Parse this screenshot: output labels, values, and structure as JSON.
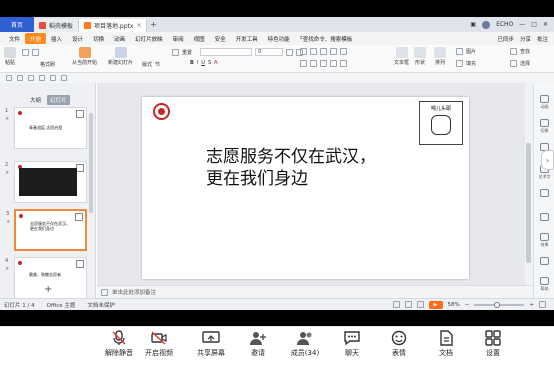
{
  "app": {
    "home_tab": "首页",
    "tabs": [
      {
        "label": "稻壳模板"
      },
      {
        "label": "项目落地.pptx"
      }
    ],
    "tab_add": "+",
    "user": "ECHO"
  },
  "menubar": {
    "items": [
      "文件",
      "开始",
      "插入",
      "设计",
      "切换",
      "动画",
      "幻灯片放映",
      "审阅",
      "视图",
      "安全",
      "开发工具",
      "特色功能"
    ],
    "search": "查找命令、搜索模板",
    "right": [
      "已同步",
      "分享",
      "批注"
    ]
  },
  "toolbar": {
    "paste": "粘贴",
    "format_painter": "格式刷",
    "play_from_current": "从当前开始",
    "new_slide": "新建幻灯片",
    "layout": "版式",
    "section": "节",
    "reset": "重置",
    "font_size": "0",
    "textbox": "文本框",
    "shape": "形状",
    "arrange": "排列",
    "image": "图片",
    "fill": "填充",
    "find": "查找",
    "select": "选择"
  },
  "leftpane": {
    "tabs": [
      "大纲",
      "幻灯片"
    ],
    "thumbs": [
      {
        "num": "1",
        "text": "青春战疫 志愿启程"
      },
      {
        "num": "2",
        "text": ""
      },
      {
        "num": "3",
        "text": "志愿服务不仅在武汉，更在我们身边"
      },
      {
        "num": "4",
        "text": "最美，致敬志愿者"
      }
    ],
    "add": "+"
  },
  "slide": {
    "line1": "志愿服务不仅在武汉，",
    "line2": "更在我们身边",
    "sticker": "嘚儿头耶"
  },
  "notes": {
    "placeholder": "单击此处添加备注"
  },
  "status": {
    "slide_index": "幻灯片 1 / 4",
    "theme": "Office 主题",
    "doc_fix": "文档未保护",
    "zoom": "58%"
  },
  "rightside": [
    "动画",
    "切换",
    "",
    "艺术字",
    "",
    "",
    "效果",
    "",
    "帮助"
  ],
  "meeting": {
    "buttons": [
      "解除静音",
      "开启视频",
      "共享屏幕",
      "邀请",
      "成员(34)",
      "聊天",
      "表情",
      "文档",
      "设置"
    ]
  }
}
